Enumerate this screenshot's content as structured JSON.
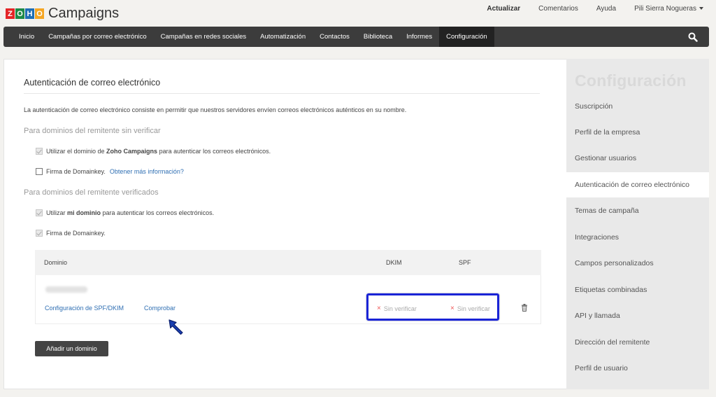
{
  "app": {
    "logo_letters": [
      "Z",
      "O",
      "H",
      "O"
    ],
    "logo_colors": [
      "#e42527",
      "#1d8a48",
      "#1f6eb5",
      "#f5a623"
    ],
    "name": "Campaigns"
  },
  "top_links": [
    {
      "label": "Actualizar",
      "bold": true
    },
    {
      "label": "Comentarios",
      "bold": false
    },
    {
      "label": "Ayuda",
      "bold": false
    },
    {
      "label": "Pili Sierra Nogueras",
      "bold": false
    }
  ],
  "nav": {
    "items": [
      "Inicio",
      "Campañas por correo electrónico",
      "Campañas en redes sociales",
      "Automatización",
      "Contactos",
      "Biblioteca",
      "Informes",
      "Configuración"
    ],
    "active_index": 7,
    "search_icon": "search-icon"
  },
  "main": {
    "title": "Autenticación de correo electrónico",
    "description": "La autenticación de correo electrónico consiste en permitir que nuestros servidores envíen correos electrónicos auténticos en su nombre.",
    "section_unverified": {
      "heading": "Para dominios del remitente sin verificar",
      "option1_pre": "Utilizar el dominio de ",
      "option1_bold": "Zoho Campaigns",
      "option1_post": " para autenticar los correos electrónicos.",
      "option2_label": "Firma de Domainkey.",
      "option2_link": "Obtener más información?"
    },
    "section_verified": {
      "heading": "Para dominios del remitente verificados",
      "option1_pre": "Utilizar ",
      "option1_bold": "mi dominio",
      "option1_post": " para autenticar los correos electrónicos.",
      "option2_label": "Firma de Domainkey."
    },
    "table": {
      "col_domain": "Dominio",
      "col_dkim": "DKIM",
      "col_spf": "SPF",
      "row": {
        "config_link": "Configuración de SPF/DKIM",
        "check_link": "Comprobar",
        "dkim_status": "Sin verificar",
        "spf_status": "Sin verificar"
      }
    },
    "add_domain_button": "Añadir un dominio"
  },
  "sidebar": {
    "title": "Configuración",
    "items": [
      "Suscripción",
      "Perfil de la empresa",
      "Gestionar usuarios",
      "Autenticación de correo electrónico",
      "Temas de campaña",
      "Integraciones",
      "Campos personalizados",
      "Etiquetas combinadas",
      "API y llamada",
      "Dirección del remitente",
      "Perfil de usuario"
    ],
    "active_index": 3
  },
  "colors": {
    "highlight_box": "#1a24d6",
    "link": "#2f6fb3",
    "nav_bg": "#3c3c3c",
    "error_x": "#e55555"
  }
}
